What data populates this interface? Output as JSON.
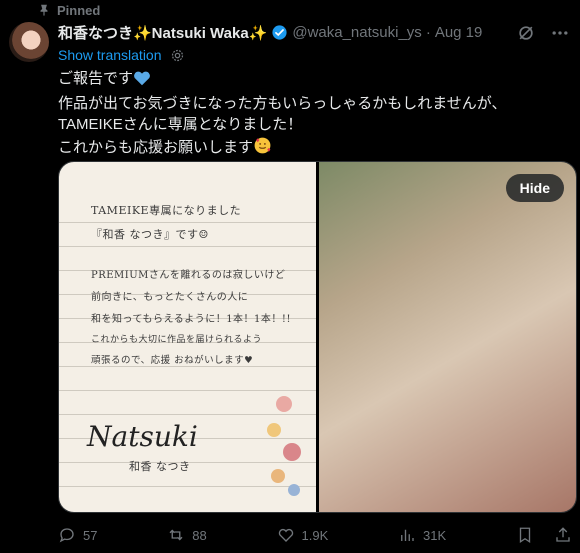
{
  "pinned": {
    "label": "Pinned",
    "icon": "pin-icon"
  },
  "author": {
    "display_name": "和香なつき✨Natsuki Waka✨",
    "handle": "@waka_natsuki_ys",
    "separator": "·",
    "date": "Aug 19",
    "verified_color": "#1d9bf0"
  },
  "translation": {
    "label": "Show translation"
  },
  "post": {
    "line1": "ご報告です",
    "line2": "作品が出てお気づきになった方もいらっしゃるかもしれませんが、",
    "line3": "TAMEIKEさんに専属となりました！",
    "line4": "これからも応援お願いします"
  },
  "media": {
    "note_lines": [
      "TAMEIKE専属になりました",
      "『和香 なつき』です☺",
      "PREMIUMさんを離れるのは寂しいけど",
      "前向きに、もっとたくさんの人に",
      "和を知ってもらえるように！1本！1本！!!",
      "これからも大切に作品を届けられるよう",
      "頑張るので、応援 おねがいします♥"
    ],
    "signature": "Natsuki",
    "signature_kana": "和香 なつき",
    "hide_label": "Hide"
  },
  "actions": {
    "replies": "57",
    "reposts": "88",
    "likes": "1.9K",
    "views": "31K"
  },
  "colors": {
    "accent": "#1d9bf0",
    "muted": "#71767b",
    "background": "#000000"
  }
}
